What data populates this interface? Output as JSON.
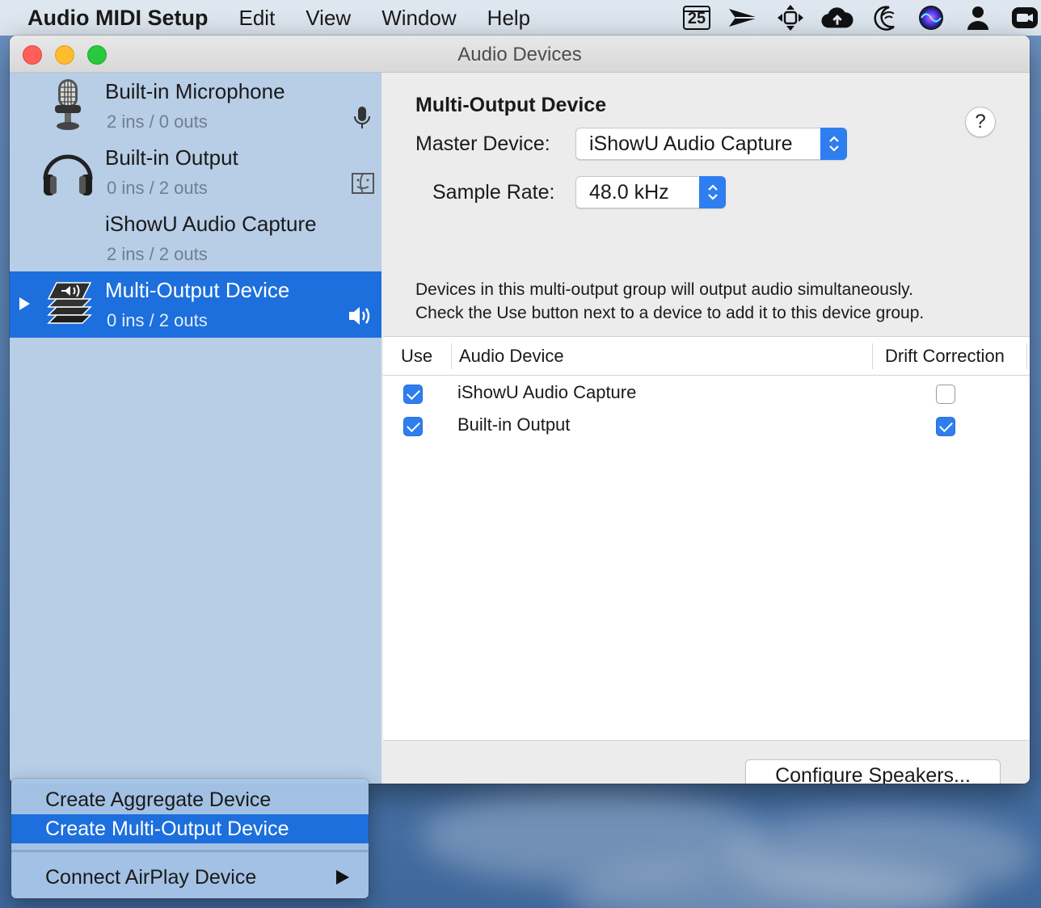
{
  "menubar": {
    "app_name": "Audio MIDI Setup",
    "menus": [
      "Edit",
      "View",
      "Window",
      "Help"
    ],
    "calendar_day": "25",
    "status_icons": [
      "calendar-icon",
      "paper-plane-icon",
      "move-arrows-icon",
      "cloud-upload-icon",
      "moon-wifi-icon",
      "siri-icon",
      "user-icon",
      "camera-icon"
    ]
  },
  "window": {
    "title": "Audio Devices"
  },
  "sidebar": {
    "devices": [
      {
        "name": "Built-in Microphone",
        "io": "2 ins / 0 outs",
        "icon": "microphone-icon",
        "status_icon": "microphone-small-icon",
        "selected": false
      },
      {
        "name": "Built-in Output",
        "io": "0 ins / 2 outs",
        "icon": "headphones-icon",
        "status_icon": "finder-icon",
        "selected": false
      },
      {
        "name": "iShowU Audio Capture",
        "io": "2 ins / 2 outs",
        "icon": "",
        "status_icon": "",
        "selected": false
      },
      {
        "name": "Multi-Output Device",
        "io": "0 ins / 2 outs",
        "icon": "stacked-speakers-icon",
        "status_icon": "speaker-volume-icon",
        "selected": true
      }
    ]
  },
  "detail": {
    "title": "Multi-Output Device",
    "help_label": "?",
    "master_label": "Master Device:",
    "master_value": "iShowU Audio Capture",
    "rate_label": "Sample Rate:",
    "rate_value": "48.0 kHz",
    "description_line1": "Devices in this multi-output group will output audio simultaneously.",
    "description_line2": "Check the Use button next to a device to add it to this device group.",
    "table": {
      "headers": [
        "Use",
        "Audio Device",
        "Drift Correction"
      ],
      "rows": [
        {
          "use": true,
          "device": "iShowU Audio Capture",
          "drift": false
        },
        {
          "use": true,
          "device": "Built-in Output",
          "drift": true
        }
      ]
    },
    "configure_button": "Configure Speakers..."
  },
  "dropdown": {
    "items": [
      "Create Aggregate Device",
      "Create Multi-Output Device",
      "Connect AirPlay Device"
    ],
    "highlighted_index": 1
  },
  "colors": {
    "accent": "#1c6fdc",
    "checkbox": "#2f7ef0",
    "sidebar": "#b8cde6"
  }
}
